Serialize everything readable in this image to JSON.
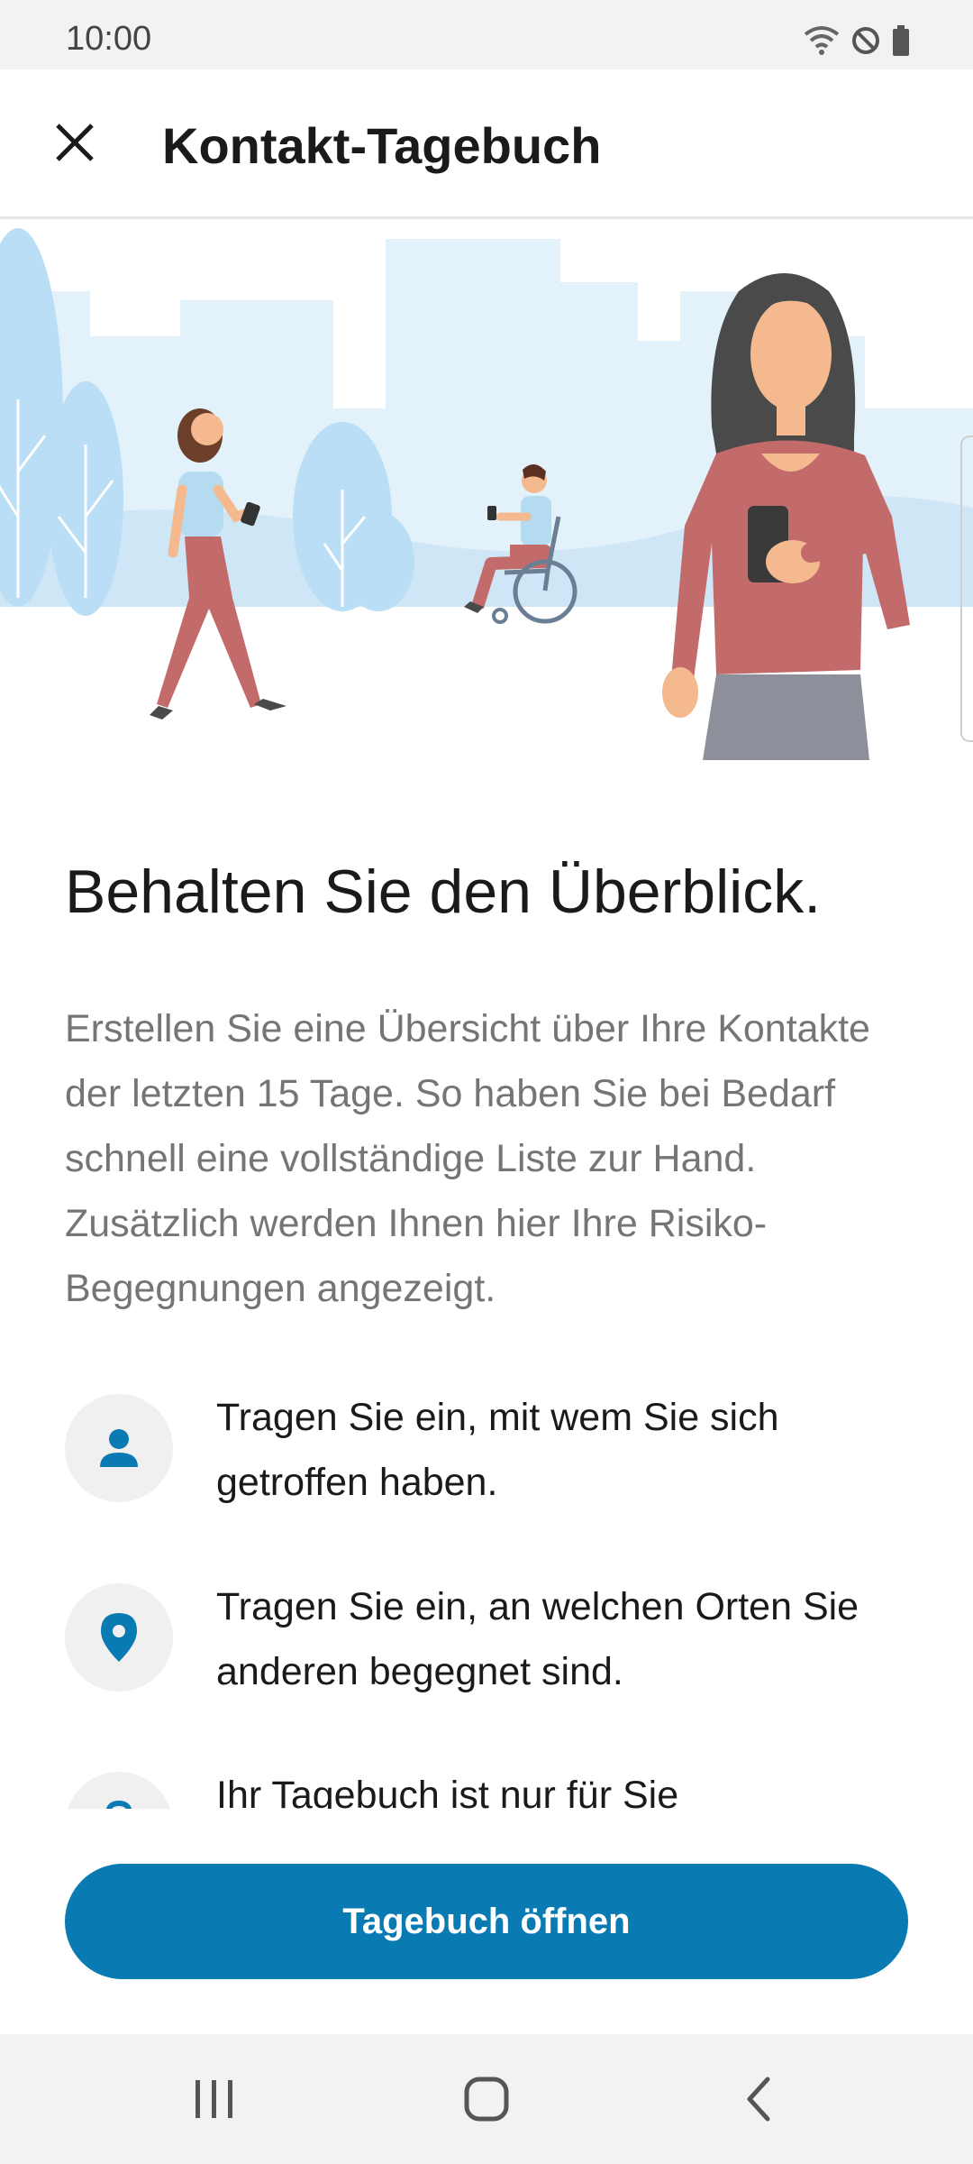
{
  "status_bar": {
    "time": "10:00",
    "icons": [
      "wifi-icon",
      "do-not-disturb-icon",
      "battery-icon"
    ]
  },
  "app_bar": {
    "title": "Kontakt-Tagebuch",
    "close_icon": "close-icon"
  },
  "main": {
    "headline": "Behalten Sie den Überblick.",
    "description": "Erstellen Sie eine Übersicht über Ihre Kontakte der letzten 15 Tage. So haben Sie bei Bedarf schnell eine vollständige Liste zur Hand. Zusätzlich werden Ihnen hier Ihre Risiko-Begegnungen angezeigt.",
    "items": [
      {
        "icon": "person-icon",
        "text": "Tragen Sie ein, mit wem Sie sich getroffen haben."
      },
      {
        "icon": "location-pin-icon",
        "text": "Tragen Sie ein, an welchen Orten Sie anderen begegnet sind."
      },
      {
        "icon": "lock-icon",
        "text": "Ihr Tagebuch ist nur für Sie"
      }
    ]
  },
  "actions": {
    "primary_label": "Tagebuch öffnen"
  },
  "colors": {
    "accent": "#0a7ab3",
    "icon_blue": "#0a7ab3",
    "body_gray": "#757575"
  },
  "nav_bar": {
    "icons": [
      "recent-apps-icon",
      "home-icon",
      "back-icon"
    ]
  }
}
